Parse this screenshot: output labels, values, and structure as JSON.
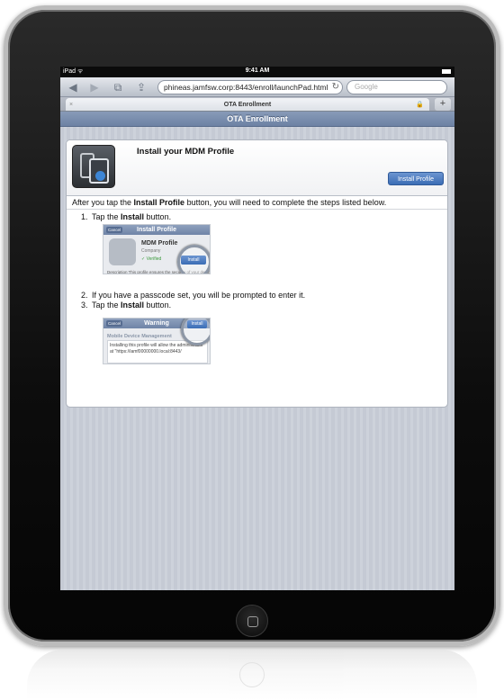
{
  "status_bar": {
    "device": "iPad",
    "wifi_icon": "wifi-icon",
    "time": "9:41 AM",
    "battery_icon": "battery-icon"
  },
  "browser": {
    "back_icon": "back-arrow-icon",
    "forward_icon": "forward-arrow-icon",
    "bookmarks_icon": "book-icon",
    "share_icon": "share-icon",
    "url": "phineas.jamfsw.corp:8443/enroll/launchPad.html",
    "reload_icon": "reload-icon",
    "search_placeholder": "Google",
    "tab_title": "OTA Enrollment",
    "tab_close": "×",
    "new_tab": "+"
  },
  "page": {
    "header": "OTA Enrollment",
    "card_title": "Install your MDM Profile",
    "install_button": "Install Profile",
    "intro_before": "After you tap the ",
    "intro_bold": "Install Profile",
    "intro_after": " button, you will need to complete the steps listed below.",
    "steps": [
      {
        "num": "1.",
        "before": "Tap the ",
        "bold": "Install",
        "after": " button."
      },
      {
        "num": "2.",
        "text": "If you have a passcode set, you will be prompted to enter it."
      },
      {
        "num": "3.",
        "before": "Tap the ",
        "bold": "Install",
        "after": " button."
      }
    ],
    "screenshot1": {
      "bar_title": "Install Profile",
      "cancel": "Cancel",
      "profile_name": "MDM Profile",
      "company": "Company",
      "verified": "✓ Verified",
      "install": "Install",
      "description": "Description   This profile ensures the security of your device"
    },
    "screenshot2": {
      "bar_title": "Warning",
      "cancel": "Cancel",
      "install": "Install",
      "subtitle": "Mobile Device Management",
      "body": "Installing this profile will allow the administrator at \"https://iamf00000000.local:8443/"
    }
  }
}
